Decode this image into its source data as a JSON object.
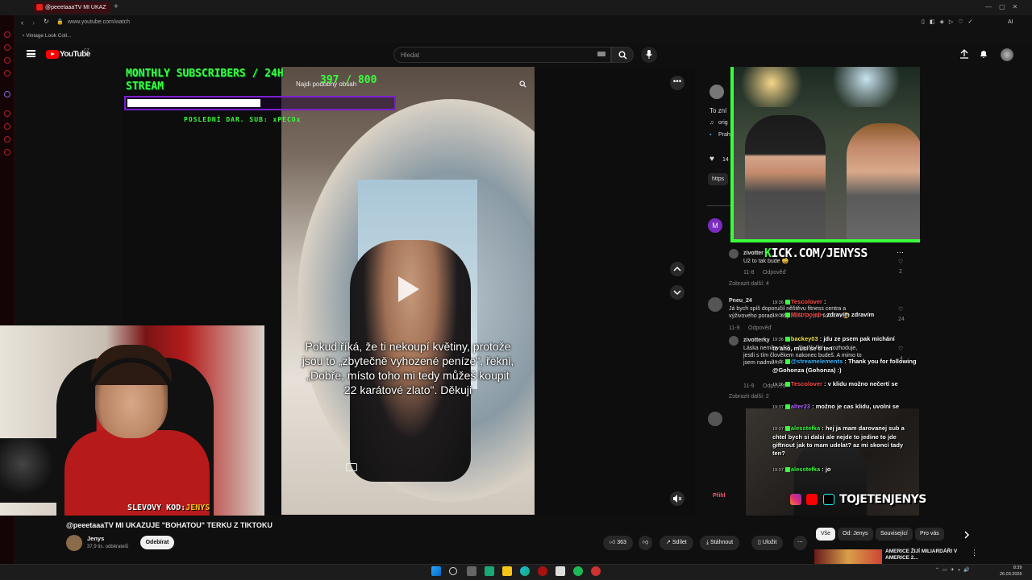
{
  "browser": {
    "tab_title": "@peeetaaaTV MI UKAZ",
    "url": "www.youtube.com/watch",
    "bookmark": "Vintage Look Coll...",
    "extension_label": "AI"
  },
  "youtube": {
    "logo_text": "YouTube",
    "logo_country": "CZ",
    "search_placeholder": "Hledat"
  },
  "overlay": {
    "title_line1": "MONTHLY SUBSCRIBERS / 24H",
    "title_line2": "STREAM",
    "count": "397 / 800",
    "progress": 0.496,
    "donation": "POSLEDNÍ DAR. SUB: xPECOx"
  },
  "video": {
    "search_placeholder": "Najdi podobný obsah",
    "caption": "Pokud říká, že ti nekoupí květiny, protože jsou to „zbytečně vyhozené peníze\", řekni, „Dobře, místo toho mi tedy můžeš koupit 22 karátové zlato\". Děkuji"
  },
  "webcam": {
    "promo_label": "SLEVOVY KOD:",
    "promo_code": "JENYS",
    "kick_prefix": "K",
    "kick_text": "ICK.COM/JENYSS",
    "social_handle": "TOJETENJENYS"
  },
  "comments": [
    {
      "author": "zivotter",
      "text": "U2 to tak bude 😀",
      "meta": "11-8",
      "reply": "Odpověď",
      "likes": "2"
    },
    {
      "author": "",
      "text": "Zobrazit další: 4",
      "meta": "",
      "reply": "",
      "likes": ""
    },
    {
      "author": "Pneu_24",
      "text": "Já bych spíš doporučil něštěvu fitness centra a výživového poradce aby měla i ty co mabízet 😀",
      "meta": "11-9",
      "reply": "Odpověď",
      "likes": "24"
    },
    {
      "author": "zivotterky",
      "text": "Láska nemilovníků ... člověk líbí ... rozhoduje, jestli s tím člověkem nakonec budeš. A mimo to jsem nadměrně",
      "meta": "11-9",
      "reply": "Odpověď",
      "likes": "4"
    },
    {
      "author": "",
      "text": "Zobrazit další: 2",
      "meta": "",
      "reply": "",
      "likes": ""
    }
  ],
  "side_text": {
    "line1": "To zní",
    "line2": "orig",
    "line3": "Praha",
    "line4": "14",
    "line5": "https",
    "avatar_letter": "M"
  },
  "chat": [
    {
      "time": "19:36",
      "user": "Tescolover",
      "user_color": "#ff4d4d",
      "msg": ":"
    },
    {
      "time": "19:36",
      "user": "Mistrpojeb",
      "user_color": "#ff4d4d",
      "msg": ": zdravím zdravím"
    },
    {
      "time": "19:36",
      "user": "backey03",
      "user_color": "#f5e642",
      "msg": ": jdu ze psem pak michání"
    },
    {
      "time": "",
      "user": "",
      "user_color": "#ffffff",
      "msg": "to ano, musí se ti ten"
    },
    {
      "time": "19:36",
      "user": "@streamelements",
      "user_color": "#3cb4ff",
      "msg": ": Thank you for following @Gohonza (Gohonza) :)"
    },
    {
      "time": "19:36",
      "user": "Tescolover",
      "user_color": "#ff4d4d",
      "msg": ": v klidu možno nečertí se"
    },
    {
      "time": "19:37",
      "user": "alter23",
      "user_color": "#b366ff",
      "msg": ": možno je cas klidu, uvolni se"
    },
    {
      "time": "19:37",
      "user": "alesstefka",
      "user_color": "#39ff3c",
      "msg": ": hej ja mam darovanej sub a chtel bych si dalsi ale nejde to jedine to jde giftnout jak to mam udelat? az mi skonci tady ten?"
    },
    {
      "time": "19:37",
      "user": "alesstefka",
      "user_color": "#39ff3c",
      "msg": ": jo"
    }
  ],
  "below_video": {
    "title": "@peeetaaaTV MI UKAZUJE \"BOHATOU\" TERKU Z TIKTOKU",
    "channel": "Jenys",
    "subs": "37,9 tis. odběratelů",
    "subscribe": "Odebírat",
    "likes": "363",
    "share": "Sdílet",
    "download": "Stáhnout",
    "save": "Uložit",
    "related_button": "Přihl"
  },
  "chips": [
    "Vše",
    "Od: Jenys",
    "Související",
    "Pro vás"
  ],
  "suggestion": {
    "title": "AMERICE ŽIJÍ MILIARDÁŘI V AMERICE 2..."
  },
  "taskbar": {
    "time": "8:39",
    "date": "26.03.2026"
  },
  "colors": {
    "accent_green": "#39ff3c",
    "accent_purple": "#7b1fd1",
    "yt_red": "#ff0000",
    "bg": "#0f0f0f"
  }
}
